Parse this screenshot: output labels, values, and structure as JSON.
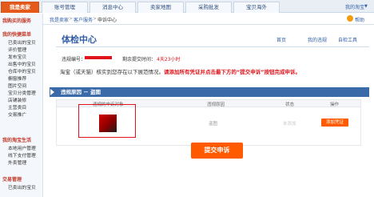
{
  "nav": {
    "tabs": [
      "我是卖家",
      "账号管理",
      "消息中心",
      "卖家地图",
      "采购批发",
      "宝贝海外"
    ],
    "active_index": 0,
    "top_right": "我的淘宝"
  },
  "breadcrumb": {
    "items": [
      "我是卖家",
      "客户服务",
      "申诉中心"
    ],
    "help": "帮助"
  },
  "sidebar": {
    "groups": [
      {
        "title": "我购买的服务",
        "items": []
      },
      {
        "title": "我的快捷菜单",
        "items": [
          "已卖出的宝贝",
          "评价管理",
          "发布宝贝",
          "出售中的宝贝",
          "仓库中的宝贝",
          "橱窗推荐",
          "图片空间",
          "宝贝分类管理",
          "店铺装修",
          "主营类目",
          "交易推广"
        ]
      },
      {
        "title": "我的淘宝生活",
        "items": [
          "本地用户管理",
          "线下支付管理",
          "外卖管理"
        ]
      },
      {
        "title": "交易管理",
        "items": [
          "已卖出的宝贝"
        ]
      }
    ]
  },
  "main": {
    "title": "体检中心",
    "links": [
      "首页",
      "我的违规",
      "自检工具"
    ],
    "violation_id_label": "违规编号：",
    "remaining_label": "剩余提交时间：",
    "remaining_value": "4天23小时",
    "warning_prefix": "淘宝（或天猫）核实到您存在以下展范情况。",
    "warning_highlight": "请添加所有凭证并点击最下方的“提交申诉”按钮完成申诉。",
    "section_title": "违规原因 － 盗图",
    "table": {
      "headers": [
        "违规的申诉对象",
        "违规原因",
        "状态",
        "操作"
      ],
      "row": {
        "reason": "盗图",
        "status": "未添加",
        "action": "添加凭证"
      }
    },
    "submit_label": "提交申诉"
  },
  "colors": {
    "accent": "#ff5a00",
    "nav_active": "#e45a1b",
    "link": "#2f5ea8",
    "section_bar": "#3a6aa8",
    "alert": "#e0141b"
  }
}
